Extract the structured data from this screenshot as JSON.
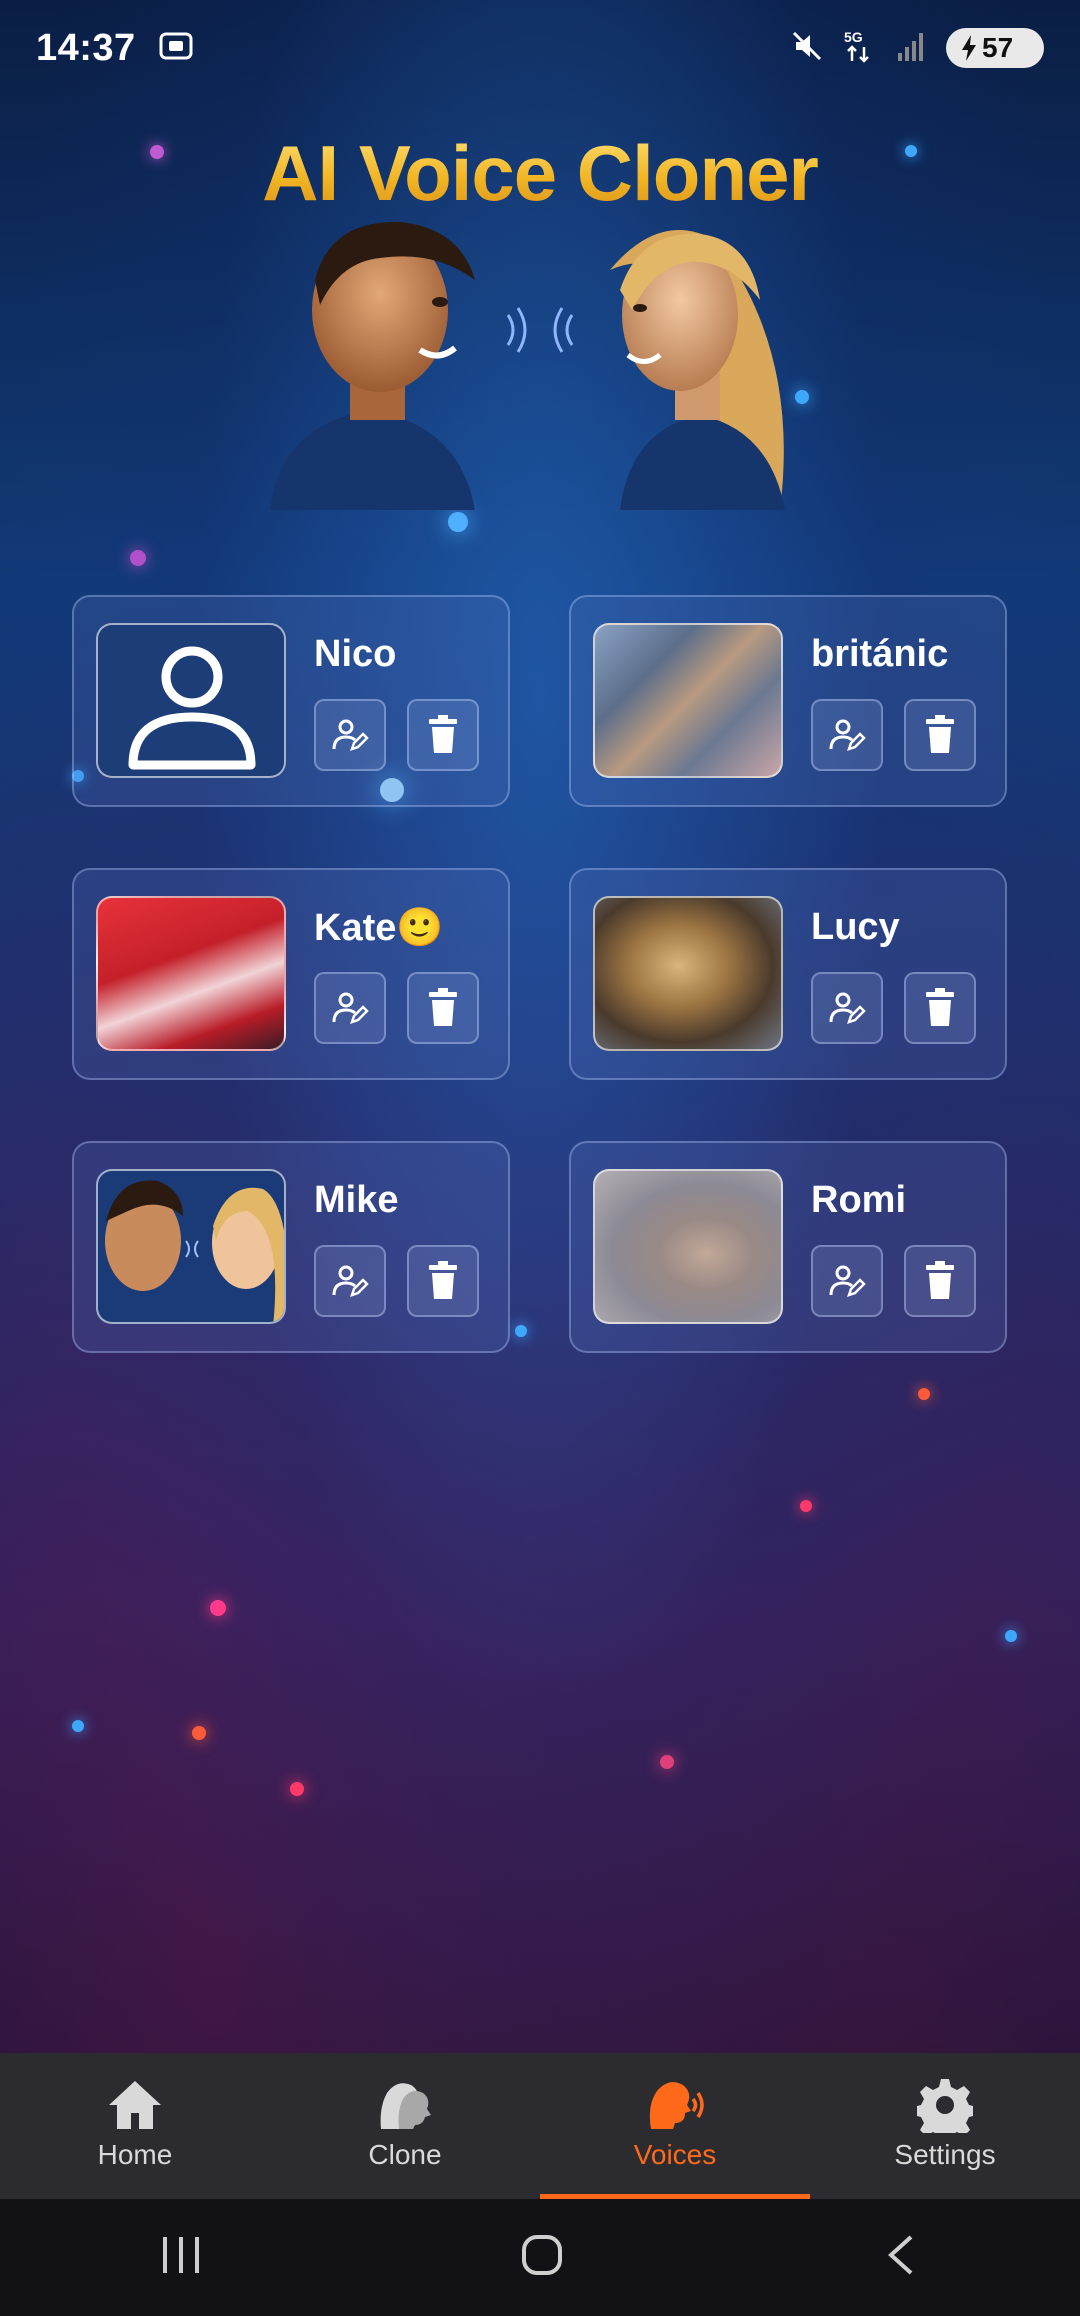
{
  "status_bar": {
    "time": "14:37",
    "battery": "57",
    "icons": [
      "screenshot-icon",
      "mute-icon",
      "5g-icon",
      "signal-icon",
      "battery-charging-icon"
    ]
  },
  "app": {
    "title": "AI Voice Cloner"
  },
  "voices": [
    {
      "name": "Nico",
      "thumb": "default-avatar"
    },
    {
      "name": "británic",
      "thumb": "fabric-photo"
    },
    {
      "name": "Kate🙂",
      "thumb": "red-sign-photo"
    },
    {
      "name": "Lucy",
      "thumb": "cat-photo"
    },
    {
      "name": "Mike",
      "thumb": "two-faces-photo"
    },
    {
      "name": "Romi",
      "thumb": "cat-blanket-photo"
    }
  ],
  "bottom_nav": {
    "items": [
      {
        "label": "Home",
        "icon": "home-icon"
      },
      {
        "label": "Clone",
        "icon": "clone-voice-icon"
      },
      {
        "label": "Voices",
        "icon": "voices-icon"
      },
      {
        "label": "Settings",
        "icon": "gear-icon"
      }
    ],
    "active": "Voices"
  },
  "colors": {
    "accent": "#ff6a1a",
    "title_gold": "#f2b523",
    "nav_bg": "#2b2b30"
  }
}
